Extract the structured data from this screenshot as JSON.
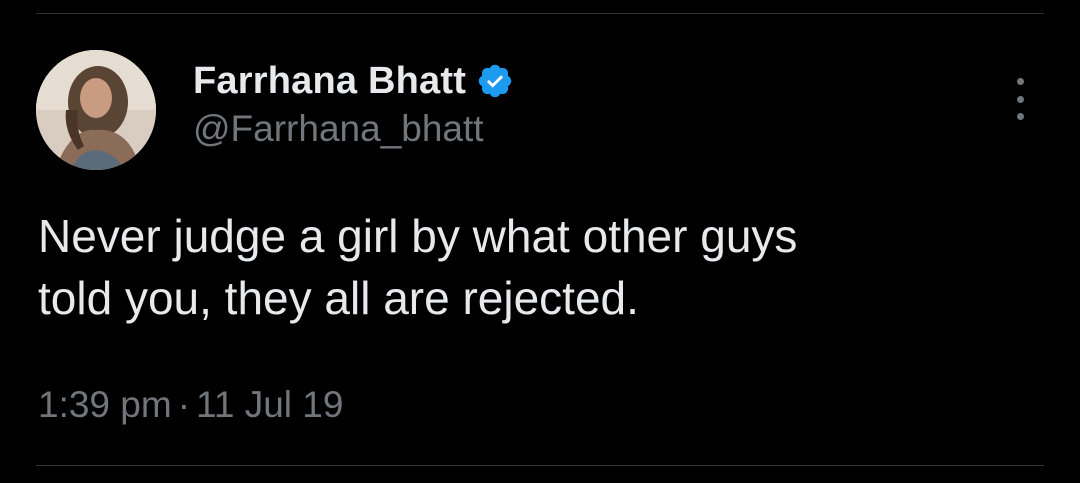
{
  "author": {
    "display_name": "Farrhana Bhatt",
    "handle": "@Farrhana_bhatt",
    "verified_icon": "verified-badge-icon",
    "avatar": "profile-photo"
  },
  "tweet": {
    "lines": [
      "Never judge a girl by what other guys",
      "told you, they all are rejected."
    ],
    "time": "1:39 pm",
    "separator": "·",
    "date": "11 Jul 19"
  },
  "menu_icon": "more-options-icon",
  "colors": {
    "background": "#000000",
    "primary_text": "#e7e9ea",
    "secondary_text": "#71767b",
    "verified_blue": "#1d9bf0",
    "divider": "#2f3336"
  }
}
